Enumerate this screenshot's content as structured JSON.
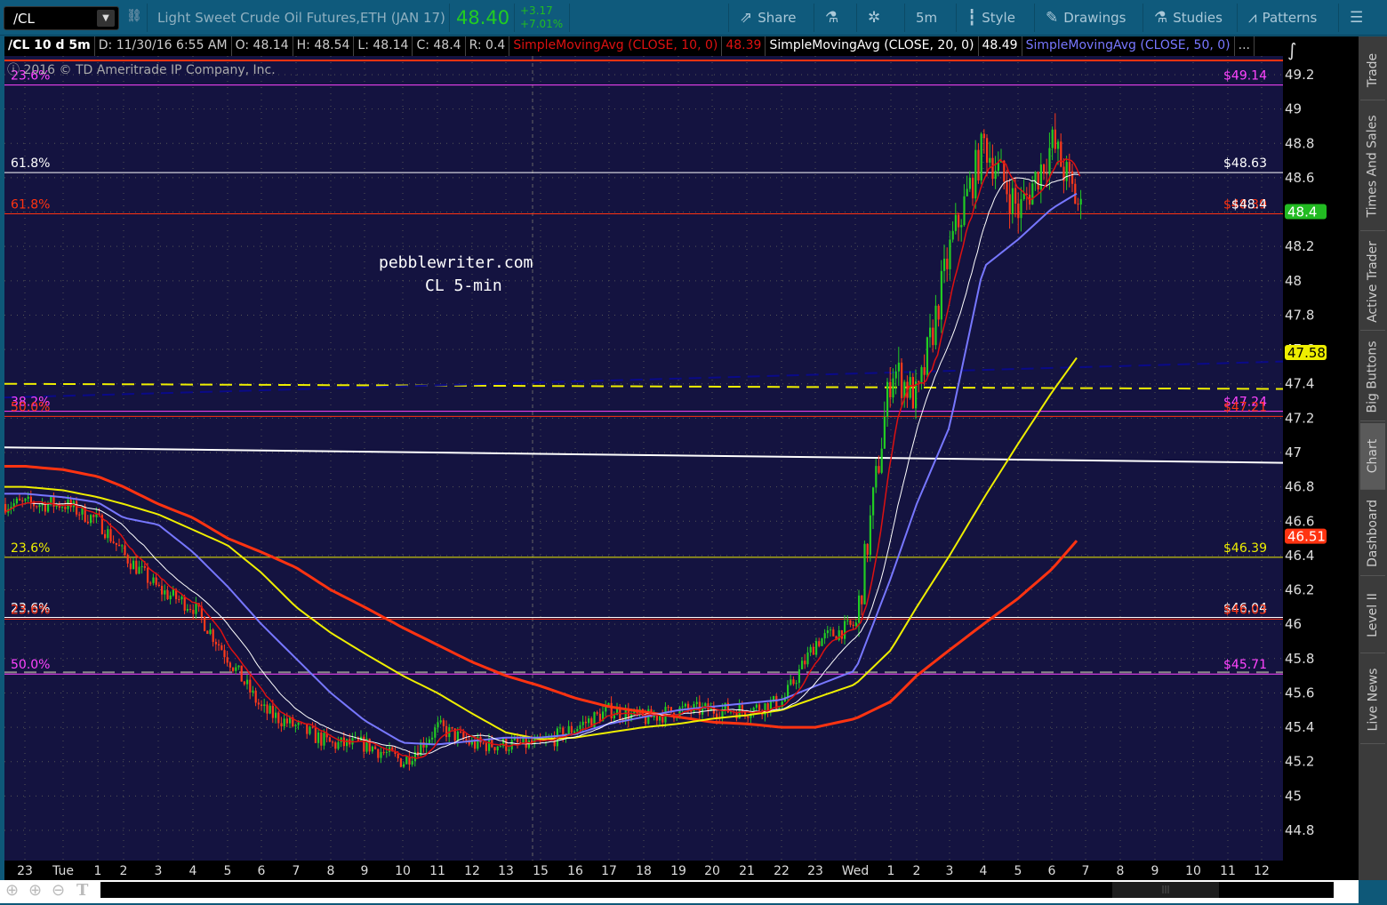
{
  "toolbar": {
    "symbol": "/CL",
    "description": "Light Sweet Crude Oil Futures,ETH (JAN 17)",
    "last": "48.40",
    "change": "+3.17",
    "change_pct": "+7.01%",
    "buttons": [
      {
        "label": "Share",
        "icon": "share-icon"
      },
      {
        "label": "",
        "icon": "flask-icon"
      },
      {
        "label": "",
        "icon": "gear-icon"
      },
      {
        "label": "5m",
        "icon": ""
      },
      {
        "label": "Style",
        "icon": "candle-icon"
      },
      {
        "label": "Drawings",
        "icon": "pencil-icon"
      },
      {
        "label": "Studies",
        "icon": "flask-icon"
      },
      {
        "label": "Patterns",
        "icon": "patterns-icon"
      },
      {
        "label": "",
        "icon": "menu-icon"
      }
    ]
  },
  "header": {
    "title": "/CL 10 d 5m",
    "date": "D: 11/30/16 6:55 AM",
    "open": "O: 48.14",
    "high": "H: 48.54",
    "low": "L: 48.14",
    "close": "C: 48.4",
    "range": "R: 0.4",
    "sma10": "SimpleMovingAvg (CLOSE, 10, 0)",
    "sma10_val": "48.39",
    "sma20": "SimpleMovingAvg (CLOSE, 20, 0)",
    "sma20_val": "48.49",
    "sma50": "SimpleMovingAvg (CLOSE, 50, 0)",
    "more": "..."
  },
  "copyright": "2016 © TD Ameritrade IP Company, Inc.",
  "watermark": {
    "line1": "pebblewriter.com",
    "line2": "CL 5-min"
  },
  "side_tabs": [
    "Trade",
    "Times And Sales",
    "Active Trader",
    "Big Buttons",
    "Chart",
    "Dashboard",
    "Level II",
    "Live News"
  ],
  "active_tab": "Chart",
  "colors": {
    "up": "#22cc22",
    "down": "#ff3a1a",
    "sma10": "#dd1111",
    "sma20": "#ffffff",
    "sma50": "#7777ff",
    "sma100": "#eeee00",
    "sma200": "#ff3311",
    "bg": "#141340"
  },
  "chart_data": {
    "type": "candlestick",
    "ylim": [
      44.65,
      49.33
    ],
    "y_ticks": [
      "49.2",
      "49",
      "48.8",
      "48.6",
      "48.4",
      "48.2",
      "48",
      "47.8",
      "47.6",
      "47.4",
      "47.2",
      "47",
      "46.8",
      "46.6",
      "46.4",
      "46.2",
      "46",
      "45.8",
      "45.6",
      "45.4",
      "45.2",
      "45",
      "44.8"
    ],
    "x_ticks": [
      "23",
      "Tue",
      "1",
      "2",
      "3",
      "4",
      "5",
      "6",
      "7",
      "8",
      "9",
      "10",
      "11",
      "12",
      "13",
      "15",
      "16",
      "17",
      "18",
      "19",
      "20",
      "21",
      "22",
      "23",
      "Wed",
      "1",
      "2",
      "3",
      "4",
      "5",
      "6",
      "7",
      "8",
      "9",
      "10",
      "11",
      "12"
    ],
    "hourly_close": [
      46.7,
      46.7,
      46.6,
      46.4,
      46.2,
      46.1,
      45.8,
      45.5,
      45.4,
      45.3,
      45.3,
      45.2,
      45.4,
      45.3,
      45.3,
      45.3,
      45.4,
      45.5,
      45.45,
      45.5,
      45.5,
      45.5,
      45.55,
      45.9,
      46.0,
      47.5,
      47.3,
      48.2,
      48.8,
      48.4,
      48.8,
      48.4
    ],
    "sma50_hourly": [
      46.76,
      46.74,
      46.71,
      46.62,
      46.58,
      46.42,
      46.22,
      46.0,
      45.8,
      45.6,
      45.44,
      45.31,
      45.3,
      45.32,
      45.34,
      45.34,
      45.36,
      45.42,
      45.46,
      45.5,
      45.52,
      45.54,
      45.56,
      45.64,
      45.73,
      46.27,
      46.7,
      47.15,
      48.08,
      48.24,
      48.42,
      48.52
    ],
    "sma100_hourly": [
      46.8,
      46.78,
      46.74,
      46.7,
      46.64,
      46.55,
      46.46,
      46.3,
      46.1,
      45.95,
      45.83,
      45.7,
      45.6,
      45.48,
      45.37,
      45.33,
      45.34,
      45.37,
      45.4,
      45.42,
      45.45,
      45.47,
      45.5,
      45.57,
      45.65,
      45.85,
      46.1,
      46.4,
      46.73,
      47.05,
      47.35,
      47.58
    ],
    "sma200_hourly": [
      46.92,
      46.9,
      46.86,
      46.8,
      46.7,
      46.62,
      46.5,
      46.42,
      46.33,
      46.2,
      46.1,
      45.98,
      45.88,
      45.78,
      45.7,
      45.64,
      45.57,
      45.52,
      45.49,
      45.46,
      45.43,
      45.42,
      45.4,
      45.4,
      45.45,
      45.55,
      45.7,
      45.85,
      46.0,
      46.15,
      46.32,
      46.51
    ],
    "fib_levels": [
      {
        "pct": "23.6%",
        "price": 49.14,
        "label": "$49.14",
        "color": "#ff44ff"
      },
      {
        "pct": "61.8%",
        "price": 48.63,
        "label": "$48.63",
        "color": "#ffffff"
      },
      {
        "pct": "61.8%",
        "price": 48.39,
        "label": "$48.39",
        "color": "#ff3311"
      },
      {
        "pct": "38.2%",
        "price": 47.24,
        "label": "$47.24",
        "color": "#ff44ff"
      },
      {
        "pct": "50.0%",
        "price": 47.21,
        "label": "$47.21",
        "color": "#ff3311"
      },
      {
        "pct": "23.6%",
        "price": 46.39,
        "label": "$46.39",
        "color": "#eeee00"
      },
      {
        "pct": "23.6%",
        "price": 46.04,
        "label": "$46.04",
        "color": "#ffffff"
      },
      {
        "pct": "23.6%",
        "price": 46.03,
        "label": "$46.03",
        "color": "#ff3311"
      },
      {
        "pct": "50.0%",
        "price": 45.71,
        "label": "$45.71",
        "color": "#ff44ff"
      }
    ],
    "overlay_label": {
      "text": "$48.4",
      "color": "#ffffff"
    },
    "price_badges": [
      {
        "value": "48.4",
        "bg": "#22bb22",
        "fg": "#fff",
        "price": 48.4
      },
      {
        "value": "47.58",
        "bg": "#eeee00",
        "fg": "#000",
        "price": 47.58
      },
      {
        "value": "46.51",
        "bg": "#ff3311",
        "fg": "#fff",
        "price": 46.51
      }
    ],
    "trendlines": [
      {
        "style": "dashed",
        "color": "#eeee00",
        "price_start": 47.4,
        "price_end": 47.37
      },
      {
        "style": "dashed",
        "color": "#0a0a88",
        "price_start": 47.32,
        "price_end": 47.53
      },
      {
        "style": "solid",
        "color": "#ffffff",
        "price_start": 47.03,
        "price_end": 46.94
      },
      {
        "style": "dashed",
        "color": "#888888",
        "price_start": 45.72,
        "price_end": 45.72
      }
    ]
  }
}
